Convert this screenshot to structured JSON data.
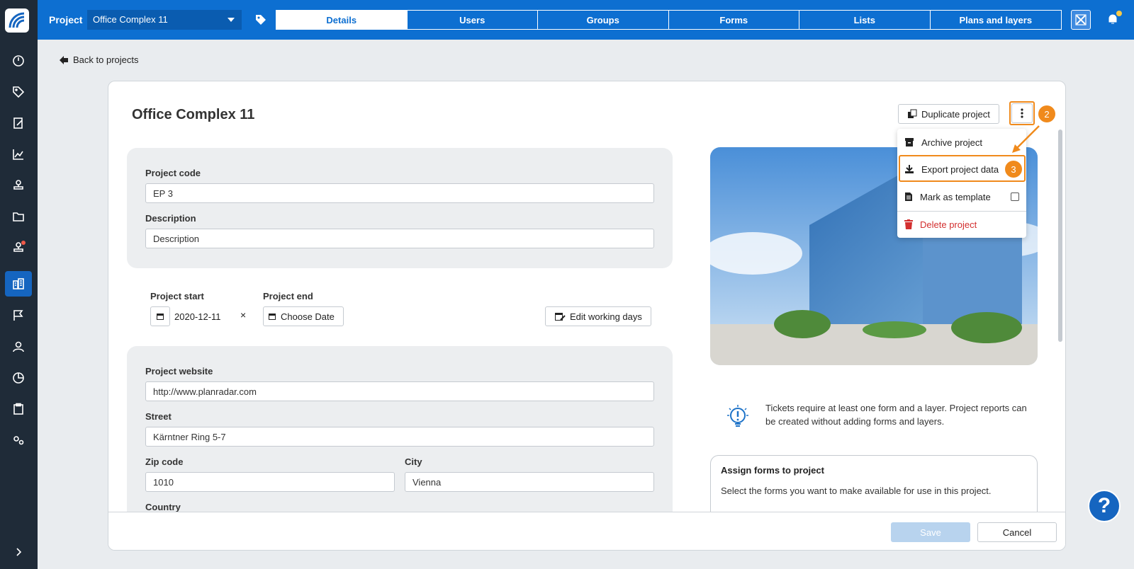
{
  "topbar": {
    "project_label": "Project",
    "project_select": "Office Complex 11",
    "tabs": [
      "Details",
      "Users",
      "Groups",
      "Forms",
      "Lists",
      "Plans and layers"
    ],
    "active_tab": "Details"
  },
  "back_link": "Back to projects",
  "card": {
    "title": "Office Complex 11",
    "duplicate_button": "Duplicate project",
    "project_code_label": "Project code",
    "project_code_value": "EP 3",
    "description_label": "Description",
    "description_placeholder": "Description",
    "project_start_label": "Project start",
    "project_start_value": "2020-12-11",
    "clear_symbol": "×",
    "project_end_label": "Project end",
    "project_end_placeholder": "Choose Date",
    "edit_working_days": "Edit working days",
    "website_label": "Project website",
    "website_value": "http://www.planradar.com",
    "street_label": "Street",
    "street_value": "Kärntner Ring 5-7",
    "zip_label": "Zip code",
    "zip_value": "1010",
    "city_label": "City",
    "city_value": "Vienna",
    "country_label": "Country",
    "tip_text": "Tickets require at least one form and a layer. Project reports can be created without adding forms and layers.",
    "assign_title": "Assign forms to project",
    "assign_text": "Select the forms you want to make available for use in this project.",
    "save_button": "Save",
    "cancel_button": "Cancel"
  },
  "menu": {
    "archive": "Archive project",
    "export": "Export project data",
    "template": "Mark as template",
    "template_checked": false,
    "delete": "Delete project"
  },
  "annotations": {
    "step_2": "2",
    "step_3": "3",
    "highlight_color": "#f08a1c"
  },
  "help_button": "?",
  "colors": {
    "brand_blue": "#0d6fd1",
    "sidebar_bg": "#1f2b38",
    "delete_red": "#d32f2f"
  }
}
